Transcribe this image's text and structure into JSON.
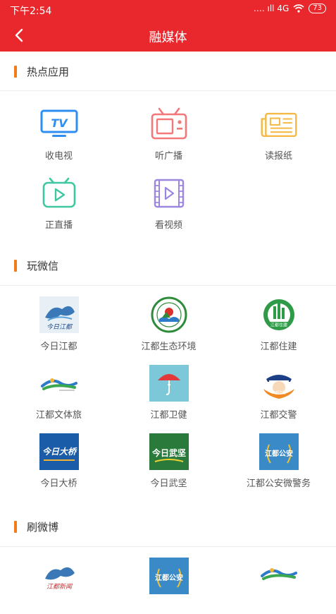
{
  "status_bar": {
    "time": "下午2:54",
    "signal": "…. ıll 4G",
    "battery": "73"
  },
  "header": {
    "title": "融媒体"
  },
  "sections": [
    {
      "title": "热点应用",
      "items": [
        {
          "label": "收电视",
          "icon": "tv-icon"
        },
        {
          "label": "听广播",
          "icon": "radio-icon"
        },
        {
          "label": "读报纸",
          "icon": "newspaper-icon"
        },
        {
          "label": "正直播",
          "icon": "live-icon"
        },
        {
          "label": "看视频",
          "icon": "video-icon"
        }
      ]
    },
    {
      "title": "玩微信",
      "items": [
        {
          "label": "今日江都",
          "icon": "jinri-jiangdu-logo",
          "logo_text": "今日江都"
        },
        {
          "label": "江都生态环境",
          "icon": "ecology-logo"
        },
        {
          "label": "江都住建",
          "icon": "zhujian-logo",
          "logo_text": "江都住建"
        },
        {
          "label": "江都文体旅",
          "icon": "wentilv-logo"
        },
        {
          "label": "江都卫健",
          "icon": "weijian-logo"
        },
        {
          "label": "江都交警",
          "icon": "jiaojing-logo",
          "logo_text": "江都交警"
        },
        {
          "label": "今日大桥",
          "icon": "daqiao-logo",
          "logo_text": "今日大桥"
        },
        {
          "label": "今日武坚",
          "icon": "wujian-logo",
          "logo_text": "今日武坚"
        },
        {
          "label": "江都公安微警务",
          "icon": "police-logo",
          "logo_text": "江都公安"
        }
      ]
    },
    {
      "title": "刷微博",
      "items": [
        {
          "label": "",
          "icon": "jiangdu-news-logo",
          "logo_text": "江都新闻"
        },
        {
          "label": "",
          "icon": "police-logo",
          "logo_text": "江都公安"
        },
        {
          "label": "",
          "icon": "wentilv-logo"
        }
      ]
    }
  ],
  "colors": {
    "brand_red": "#e8282d",
    "accent_orange": "#f07d1a"
  }
}
